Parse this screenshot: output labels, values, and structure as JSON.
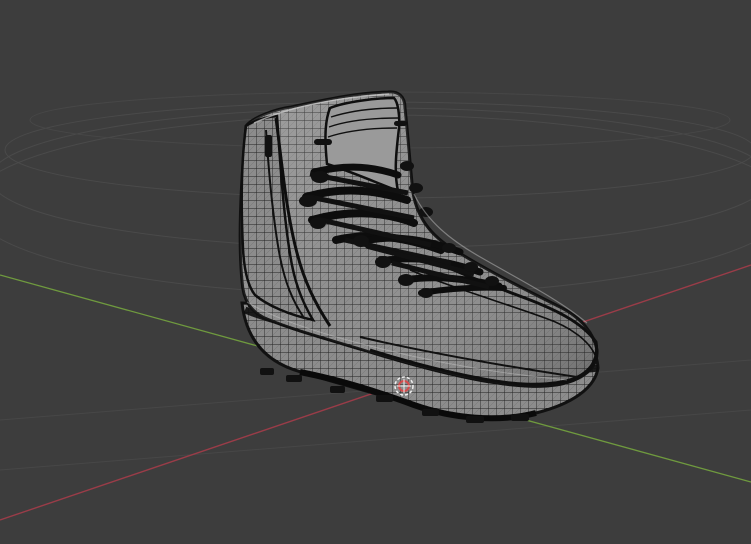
{
  "scene": {
    "object_name": "boot-mesh",
    "view_mode": "wireframe",
    "colors": {
      "background": "#3d3d3d",
      "grid_line": "#4a4a4a",
      "x_axis": "#9a3c48",
      "y_axis": "#6f9a3e",
      "mesh_fill": "#8f8f8f",
      "mesh_wire": "#1f1f1f",
      "mesh_highlight": "#cfcfcf",
      "laces": "#0d0d0d",
      "origin_marker": "#d44c4c"
    }
  }
}
